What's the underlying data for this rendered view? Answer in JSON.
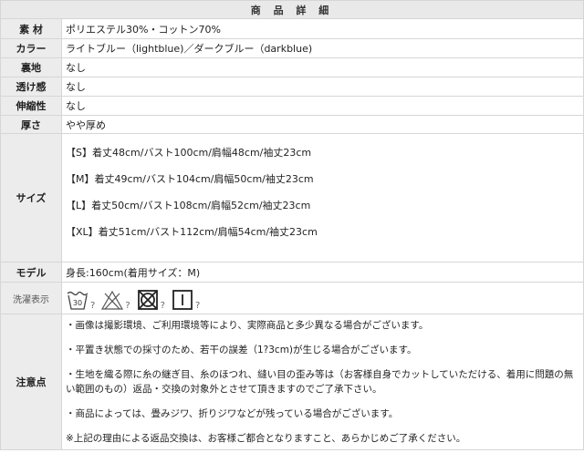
{
  "header": {
    "title": "商 品 詳 細"
  },
  "rows": [
    {
      "label": "素 材",
      "value": "ポリエステル30%・コットン70%"
    },
    {
      "label": "カラー",
      "value": "ライトブルー（lightblue)／ダークブルー（darkblue)"
    },
    {
      "label": "裏地",
      "value": "なし"
    },
    {
      "label": "透け感",
      "value": "なし"
    },
    {
      "label": "伸縮性",
      "value": "なし"
    },
    {
      "label": "厚さ",
      "value": "やや厚め"
    }
  ],
  "size": {
    "label": "サイズ",
    "lines": [
      "【S】着丈48cm/バスト100cm/肩幅48cm/袖丈23cm",
      "【M】着丈49cm/バスト104cm/肩幅50cm/袖丈23cm",
      "【L】着丈50cm/バスト108cm/肩幅52cm/袖丈23cm",
      "【XL】着丈51cm/バスト112cm/肩幅54cm/袖丈23cm"
    ]
  },
  "model": {
    "label": "モデル",
    "value": "身長:160cm(着用サイズ：M)"
  },
  "care": {
    "label": "洗濯表示",
    "wash_temp": "30",
    "icons": [
      "wash-30-icon",
      "no-bleach-icon",
      "no-tumble-dry-icon",
      "line-dry-icon"
    ],
    "mark": "?"
  },
  "notes": {
    "label": "注意点",
    "lines": [
      "・画像は撮影環境、ご利用環境等により、実際商品と多少異なる場合がございます。",
      "・平置き状態での採寸のため、若干の誤差（1?3cm)が生じる場合がございます。",
      "・生地を織る際に糸の継ぎ目、糸のほつれ、縫い目の歪み等は（お客様自身でカットしていただける、着用に問題の無",
      "い範囲のもの）返品・交換の対象外とさせて頂きますのでご了承下さい。",
      "・商品によっては、畳みジワ、折りジワなどが残っている場合がございます。",
      "※上記の理由による返品交換は、お客様ご都合となりますこと、あらかじめご了承ください。"
    ]
  }
}
